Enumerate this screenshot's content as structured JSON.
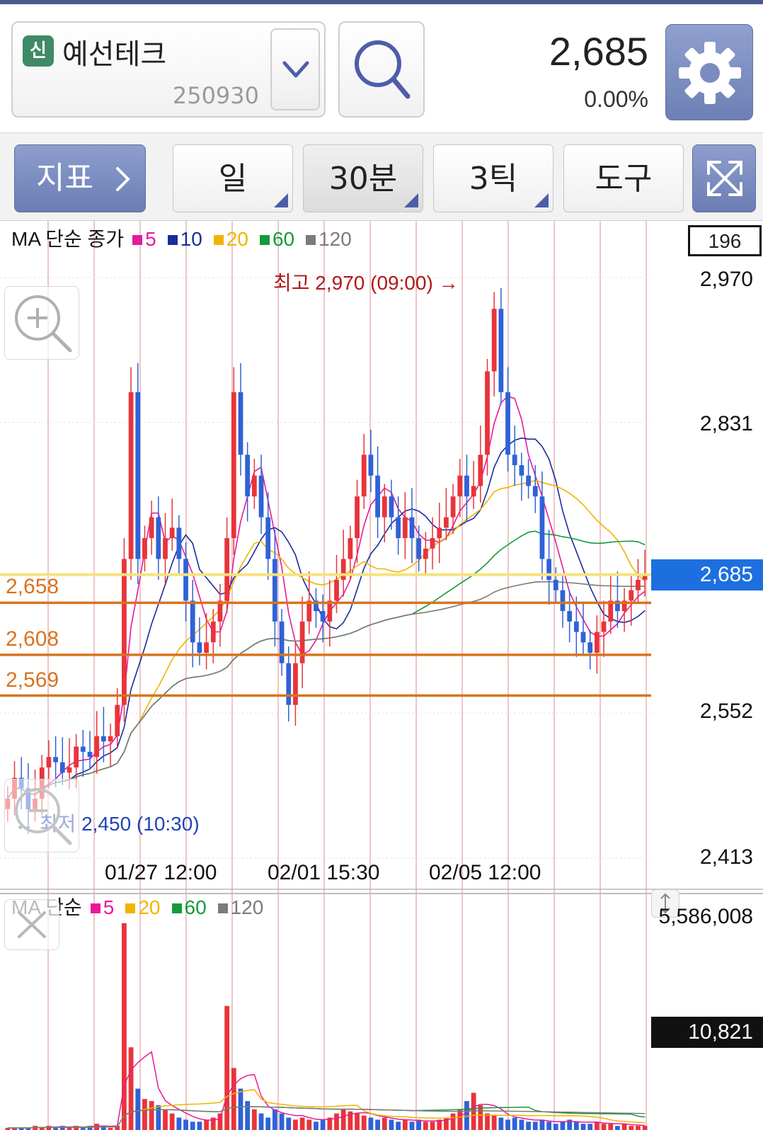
{
  "header": {
    "badge": "신",
    "stock_name": "예선테크",
    "stock_code": "250930",
    "price": "2,685",
    "change_pct": "0.00%"
  },
  "toolbar": {
    "indicator_label": "지표",
    "period_day": "일",
    "period_30min": "30분",
    "period_tick": "3틱",
    "tools_label": "도구"
  },
  "price_legend": {
    "prefix": "MA 단순 종가",
    "items": [
      {
        "label": "5",
        "color": "#e8199b"
      },
      {
        "label": "10",
        "color": "#1a2c9c"
      },
      {
        "label": "20",
        "color": "#f0b400"
      },
      {
        "label": "60",
        "color": "#139a3a"
      },
      {
        "label": "120",
        "color": "#7b7b7b"
      }
    ]
  },
  "volume_legend": {
    "prefix": "MA 단순",
    "items": [
      {
        "label": "5",
        "color": "#e8199b"
      },
      {
        "label": "20",
        "color": "#f0b400"
      },
      {
        "label": "60",
        "color": "#139a3a"
      },
      {
        "label": "120",
        "color": "#7b7b7b"
      }
    ]
  },
  "chart": {
    "visible_count": "196",
    "y_axis_labels": [
      "2,970",
      "2,831",
      "2,552",
      "2,413"
    ],
    "current_price_tag": "2,685",
    "levels": [
      {
        "label": "2,658",
        "value": 2658
      },
      {
        "label": "2,608",
        "value": 2608
      },
      {
        "label": "2,569",
        "value": 2569
      }
    ],
    "high_annotation": "최고 2,970 (09:00) →",
    "low_annotation": "← 최저 2,450 (10:30)",
    "x_labels": [
      "01/27 12:00",
      "02/01 15:30",
      "02/05 12:00"
    ],
    "volume_max_label": "5,586,008",
    "volume_current_tag": "10,821"
  },
  "colors": {
    "up": "#e8343a",
    "down": "#2f62d6",
    "level": "#d8731f",
    "current_line": "#f6e27a",
    "accent": "#1d6fe0"
  },
  "chart_data": {
    "type": "candlestick",
    "timeframe": "30분",
    "y_axis_ticks": [
      2970,
      2831,
      2552,
      2413
    ],
    "high": {
      "value": 2970,
      "time": "09:00"
    },
    "low": {
      "value": 2450,
      "time": "10:30"
    },
    "current_price": 2685,
    "support_levels": [
      2658,
      2608,
      2569
    ],
    "x_tick_labels": [
      "01/27 12:00",
      "02/01 15:30",
      "02/05 12:00"
    ],
    "close_series": [
      2470,
      2490,
      2480,
      2460,
      2470,
      2500,
      2510,
      2505,
      2495,
      2500,
      2520,
      2515,
      2510,
      2530,
      2525,
      2530,
      2560,
      2700,
      2860,
      2700,
      2720,
      2740,
      2700,
      2720,
      2730,
      2700,
      2660,
      2620,
      2610,
      2620,
      2640,
      2660,
      2720,
      2860,
      2800,
      2760,
      2780,
      2740,
      2700,
      2640,
      2600,
      2560,
      2600,
      2640,
      2660,
      2650,
      2640,
      2660,
      2680,
      2700,
      2720,
      2760,
      2800,
      2780,
      2740,
      2760,
      2740,
      2720,
      2740,
      2720,
      2700,
      2710,
      2720,
      2730,
      2740,
      2760,
      2780,
      2760,
      2770,
      2800,
      2880,
      2940,
      2860,
      2800,
      2790,
      2780,
      2770,
      2760,
      2700,
      2680,
      2670,
      2650,
      2640,
      2630,
      2620,
      2610,
      2630,
      2640,
      2660,
      2650,
      2660,
      2670,
      2680,
      2685
    ],
    "volume_series": [
      1,
      1,
      1,
      1,
      2,
      1,
      2,
      1,
      2,
      1,
      2,
      1,
      2,
      3,
      2,
      1,
      2,
      100,
      40,
      20,
      15,
      14,
      12,
      10,
      8,
      6,
      5,
      4,
      4,
      5,
      6,
      8,
      60,
      30,
      20,
      14,
      10,
      8,
      6,
      10,
      8,
      6,
      5,
      6,
      5,
      4,
      5,
      6,
      8,
      10,
      9,
      8,
      7,
      6,
      5,
      6,
      5,
      4,
      5,
      4,
      5,
      4,
      4,
      5,
      6,
      8,
      10,
      14,
      18,
      12,
      8,
      7,
      6,
      5,
      6,
      5,
      4,
      4,
      5,
      4,
      3,
      4,
      5,
      4,
      3,
      3,
      4,
      3,
      3,
      2,
      3,
      2,
      2,
      2
    ]
  }
}
